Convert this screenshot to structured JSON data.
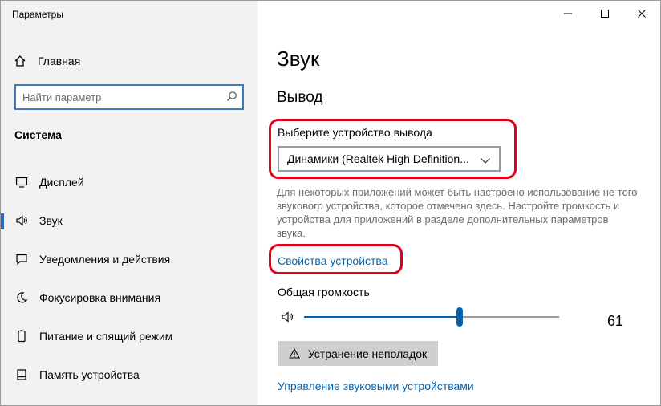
{
  "window": {
    "title": "Параметры",
    "minimize_symbol": "—",
    "maximize_symbol": "☐",
    "close_symbol": "✕"
  },
  "sidebar": {
    "home_label": "Главная",
    "home_icon": "home-icon",
    "search_placeholder": "Найти параметр",
    "search_icon": "search-icon",
    "section_label": "Система",
    "items": [
      {
        "label": "Дисплей",
        "icon": "display-icon",
        "active": false
      },
      {
        "label": "Звук",
        "icon": "speaker-icon",
        "active": true
      },
      {
        "label": "Уведомления и действия",
        "icon": "notifications-icon",
        "active": false
      },
      {
        "label": "Фокусировка внимания",
        "icon": "moon-icon",
        "active": false
      },
      {
        "label": "Питание и спящий режим",
        "icon": "power-icon",
        "active": false
      },
      {
        "label": "Память устройства",
        "icon": "storage-icon",
        "active": false
      }
    ]
  },
  "main": {
    "title": "Звук",
    "output_heading": "Вывод",
    "output_device_label": "Выберите устройство вывода",
    "output_device_value": "Динамики (Realtek High Definition...",
    "description": "Для некоторых приложений может быть настроено использование не того звукового устройства, которое отмечено здесь. Настройте громкость и устройства для приложений в разделе дополнительных параметров звука.",
    "device_properties_link": "Свойства устройства",
    "volume_label": "Общая громкость",
    "volume_value": 61,
    "volume_display": "61",
    "troubleshoot_button": "Устранение неполадок",
    "manage_devices_link": "Управление звуковыми устройствами"
  },
  "colors": {
    "accent": "#0063b1",
    "link": "#0066b4",
    "highlight_annotation": "#e0001b",
    "sidebar_bg": "#f2f2f2"
  }
}
